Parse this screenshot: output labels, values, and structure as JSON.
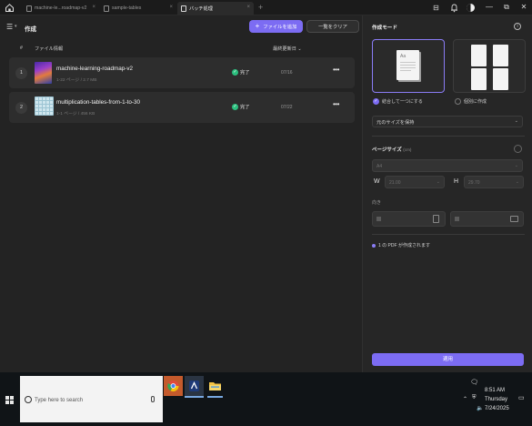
{
  "tabs": [
    {
      "label": "machine-le...roadmap-v2",
      "active": false
    },
    {
      "label": "sample-tables",
      "active": false
    },
    {
      "label": "バッチ処理",
      "active": true
    }
  ],
  "toolbar": {
    "title": "作成",
    "add_files": "ファイルを追加",
    "clear_list": "一覧をクリア"
  },
  "table": {
    "col_num": "#",
    "col_info": "ファイル情報",
    "col_modified": "最終更新日",
    "rows": [
      {
        "num": "1",
        "name": "machine-learning-roadmap-v2",
        "pages": "1-22 ページ",
        "size": "2.7 MB",
        "status": "完了",
        "date": "07/16"
      },
      {
        "num": "2",
        "name": "multiplication-tables-from-1-to-30",
        "pages": "1-1 ページ",
        "size": "456 KB",
        "status": "完了",
        "date": "07/22"
      }
    ]
  },
  "panel": {
    "title": "作成モード",
    "mode_merge": "結合して一つにする",
    "mode_individual": "個別に作成",
    "size_select": "元のサイズを保持",
    "page_size_title": "ページサイズ",
    "page_size_unit": "(cm)",
    "paper": "A4",
    "w_label": "W",
    "w_value": "21.00",
    "h_label": "H",
    "h_value": "29.70",
    "orientation_label": "向き",
    "note": "1 の PDF が作成されます",
    "apply": "適用"
  },
  "taskbar": {
    "search_placeholder": "Type here to search",
    "time": "8:51 AM",
    "day": "Thursday",
    "date": "7/24/2025"
  },
  "colors": {
    "accent": "#7c6cf3",
    "success": "#2bbf7e",
    "background": "#232323",
    "panel": "#262626"
  }
}
